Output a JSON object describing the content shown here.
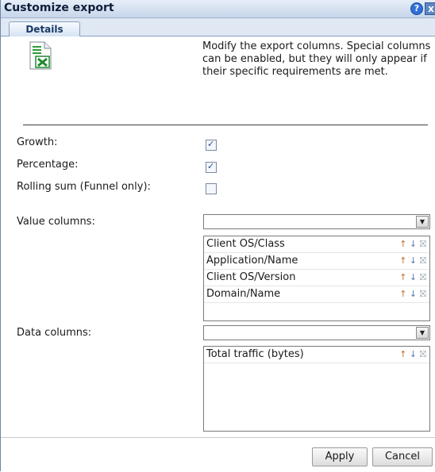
{
  "dialog": {
    "title": "Customize export",
    "help_glyph": "?",
    "close_glyph": "x"
  },
  "tabs": [
    {
      "label": "Details",
      "active": true
    }
  ],
  "description": "Modify the export columns. Special columns can be enabled, but they will only appear if their specific requirements are met.",
  "icon": {
    "name": "excel-file-icon",
    "accent": "#1f8a2e"
  },
  "options": [
    {
      "label": "Growth:",
      "checked": true
    },
    {
      "label": "Percentage:",
      "checked": true
    },
    {
      "label": "Rolling sum (Funnel only):",
      "checked": false
    }
  ],
  "value_columns": {
    "label": "Value columns:",
    "selected": "",
    "items": [
      "Client OS/Class",
      "Application/Name",
      "Client OS/Version",
      "Domain/Name"
    ]
  },
  "data_columns": {
    "label": "Data columns:",
    "selected": "",
    "items": [
      "Total traffic (bytes)"
    ]
  },
  "buttons": {
    "apply": "Apply",
    "cancel": "Cancel"
  },
  "colors": {
    "titlebar": "#c7d6ea",
    "border": "#6c87a8"
  }
}
